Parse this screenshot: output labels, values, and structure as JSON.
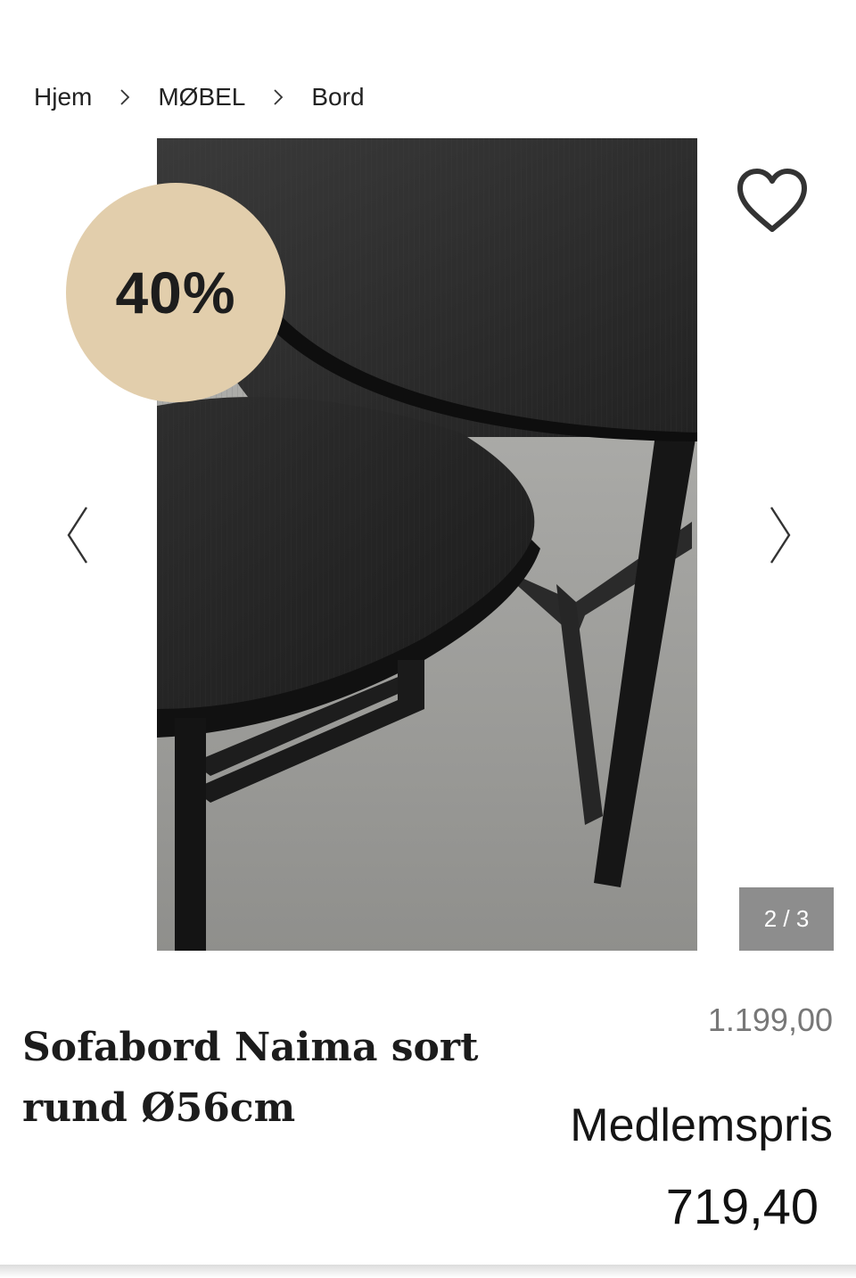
{
  "breadcrumb": {
    "items": [
      "Hjem",
      "MØBEL",
      "Bord"
    ]
  },
  "product": {
    "discount_badge": "40%",
    "image_counter": "2 / 3",
    "title": "Sofabord Naima sort rund Ø56cm",
    "old_price": "1.199,00",
    "member_label": "Medlemspris",
    "member_price": "719,40"
  },
  "icons": {
    "favorite": "heart-icon",
    "prev": "chevron-left-icon",
    "next": "chevron-right-icon",
    "separator": "chevron-right-small-icon"
  },
  "colors": {
    "badge": "#e2ceac",
    "counter_bg": "#8d8d8d",
    "old_price": "#777777"
  }
}
